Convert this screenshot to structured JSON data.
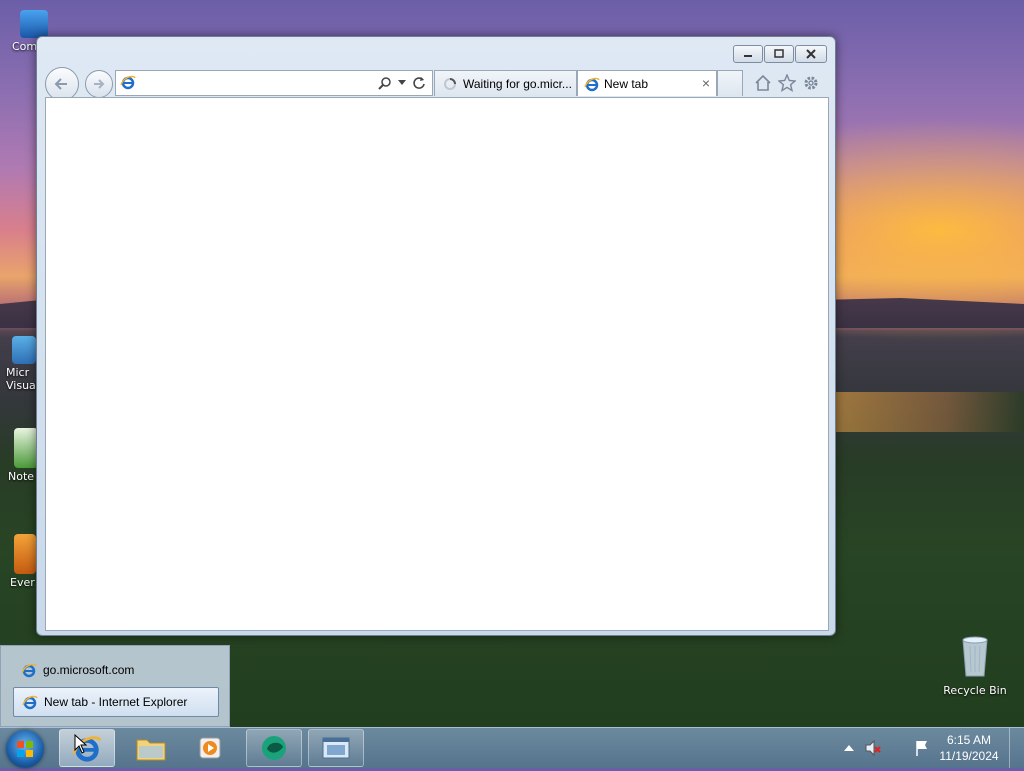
{
  "desktop": {
    "icons": [
      {
        "label": "Com"
      },
      {
        "label": "Micr\nVisual"
      },
      {
        "label": "Note"
      },
      {
        "label": "Ever"
      },
      {
        "label": "Recycle Bin"
      }
    ]
  },
  "browser": {
    "address_value": "",
    "tabs": [
      {
        "label": "Waiting for go.micr..."
      },
      {
        "label": "New tab"
      }
    ],
    "close_tab_glyph": "×"
  },
  "jumplist": {
    "items": [
      {
        "label": "go.microsoft.com"
      },
      {
        "label": "New tab - Internet Explorer"
      }
    ]
  },
  "taskbar": {
    "clock_time": "6:15 AM",
    "clock_date": "11/19/2024"
  },
  "colors": {
    "ie_blue": "#1e6fc9",
    "ie_gold": "#f2b233",
    "taskbar": "#6f8fb0"
  }
}
